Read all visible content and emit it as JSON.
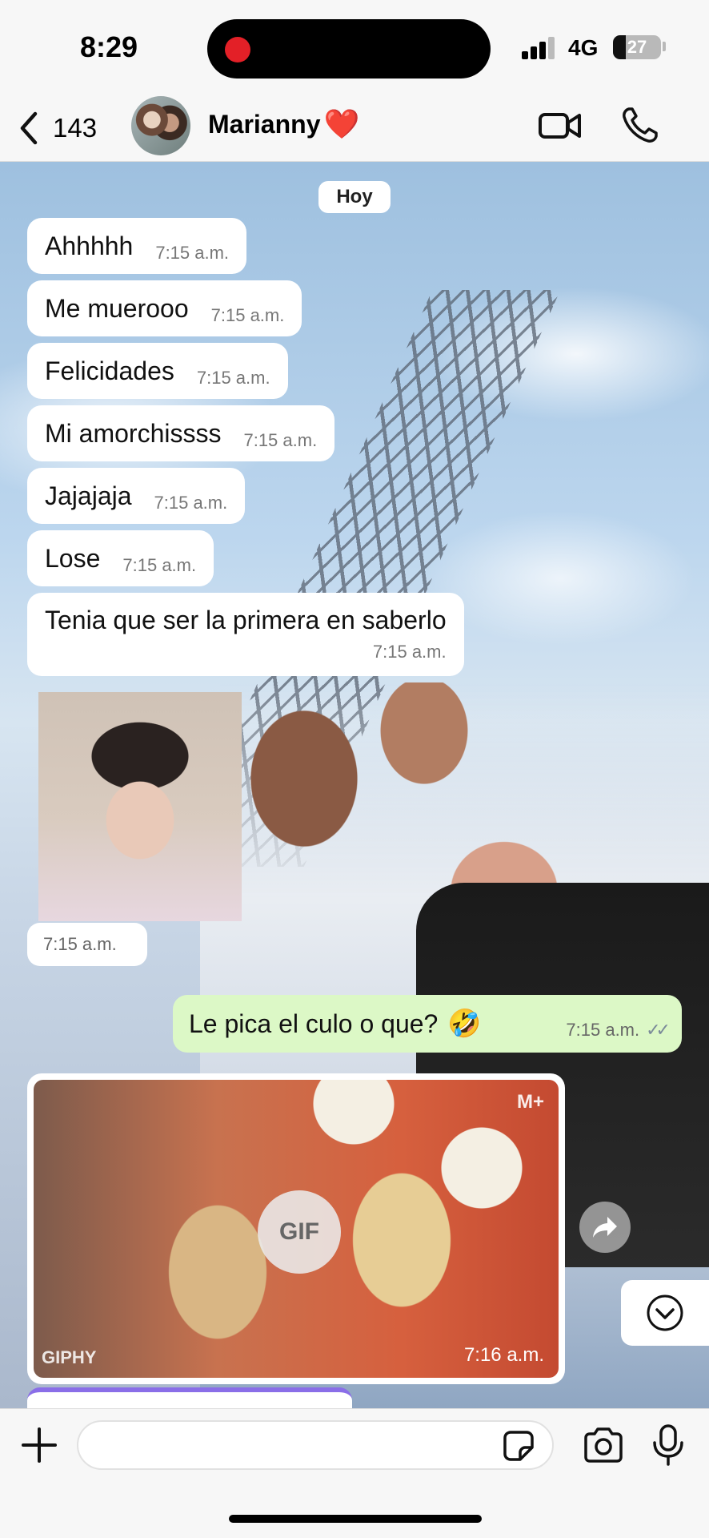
{
  "status_bar": {
    "time": "8:29",
    "network": "4G",
    "battery_level": "27",
    "battery_fraction": 0.27
  },
  "header": {
    "back_count": "143",
    "contact_name": "Marianny",
    "contact_emoji": "❤️",
    "icons": {
      "back": "chevron-left-icon",
      "video": "video-camera-icon",
      "call": "phone-icon"
    }
  },
  "chat": {
    "date_separator": "Hoy",
    "incoming_messages": [
      {
        "text": "Ahhhhh",
        "time": "7:15 a.m."
      },
      {
        "text": "Me muerooo",
        "time": "7:15 a.m."
      },
      {
        "text": "Felicidades",
        "time": "7:15 a.m."
      },
      {
        "text": "Mi amorchissss",
        "time": "7:15 a.m."
      },
      {
        "text": "Jajajaja",
        "time": "7:15 a.m."
      },
      {
        "text": "Lose",
        "time": "7:15 a.m."
      },
      {
        "text": "Tenia que ser la primera en saberlo",
        "time": "7:15 a.m."
      }
    ],
    "sticker_time": "7:15 a.m.",
    "outgoing_message": {
      "text": "Le pica el culo o que?",
      "emoji": "🤣",
      "time": "7:15 a.m."
    },
    "gif_message": {
      "badge": "GIF",
      "watermark": "GIPHY",
      "brand": "M+",
      "time": "7:16 a.m."
    }
  },
  "input_bar": {
    "placeholder": "",
    "icons": {
      "plus": "plus-icon",
      "sticker": "sticker-icon",
      "camera": "camera-icon",
      "mic": "microphone-icon"
    }
  }
}
